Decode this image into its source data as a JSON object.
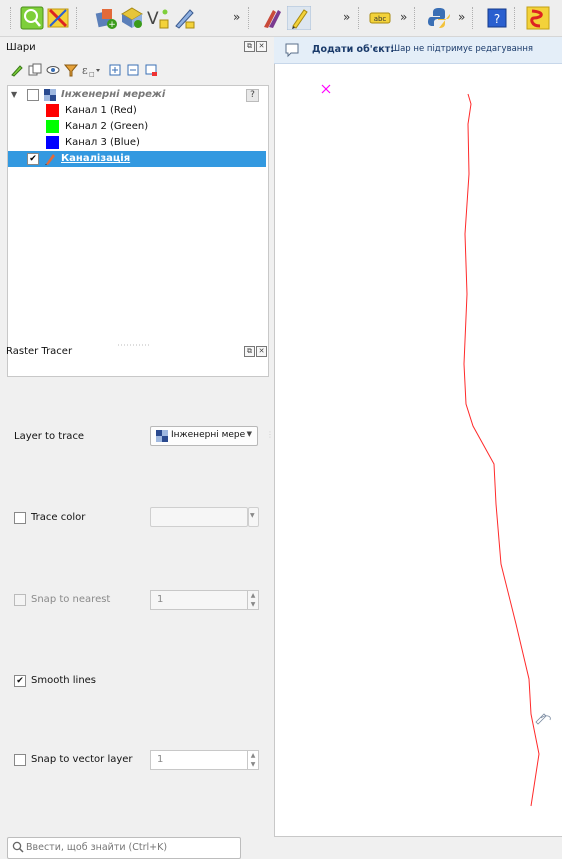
{
  "layers_panel": {
    "title": "Шари",
    "tree": [
      {
        "name": "Інженерні мережі",
        "type": "raster-group",
        "checked": false,
        "expanded": true,
        "badge": "?"
      },
      {
        "name": "Канал 1 (Red)",
        "type": "band",
        "color": "#ff0000"
      },
      {
        "name": "Канал 2 (Green)",
        "type": "band",
        "color": "#00ff00"
      },
      {
        "name": "Канал 3 (Blue)",
        "type": "band",
        "color": "#0000ff"
      },
      {
        "name": "Каналізація",
        "type": "vector-line",
        "checked": true,
        "selected": true
      }
    ]
  },
  "raster_tracer": {
    "title": "Raster Tracer",
    "layer_to_trace": {
      "label": "Layer to trace",
      "value": "Інженерні мере"
    },
    "trace_color": {
      "label": "Trace color",
      "checked": false
    },
    "snap_to_nearest": {
      "label": "Snap to nearest",
      "checked": false,
      "enabled": false,
      "value": "1"
    },
    "smooth_lines": {
      "label": "Smooth lines",
      "checked": true
    },
    "snap_to_vector": {
      "label": "Snap to vector layer",
      "checked": false,
      "value": "1"
    }
  },
  "search": {
    "placeholder": "Ввести, щоб знайти (Ctrl+K)"
  },
  "message_bar": {
    "title": "Додати об'єкт:",
    "text": "Шар не підтримує редагування"
  },
  "colors": {
    "selection": "#3399e0",
    "trace_line": "#ff2a2a",
    "marker": "#ff00ff"
  }
}
